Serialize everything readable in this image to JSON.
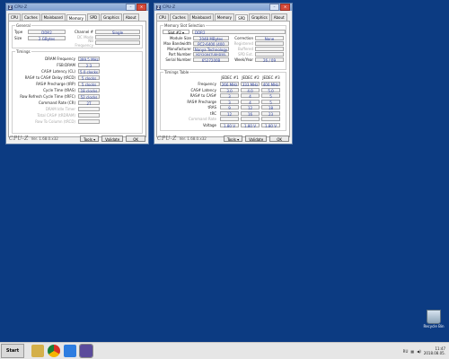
{
  "win1": {
    "title": "CPU-Z",
    "tabs": [
      "CPU",
      "Caches",
      "Mainboard",
      "Memory",
      "SPD",
      "Graphics",
      "About"
    ],
    "active_tab": "Memory",
    "general": {
      "title": "General",
      "type_label": "Type",
      "type_value": "DDR2",
      "size_label": "Size",
      "size_value": "2 GBytes",
      "channel_label": "Channel #",
      "channel_value": "Single",
      "dcmode_label": "DC Mode",
      "nbfreq_label": "NB Frequency"
    },
    "timings": {
      "title": "Timings",
      "rows": [
        {
          "label": "DRAM Frequency",
          "value": "399.5 MHz",
          "dim": false
        },
        {
          "label": "FSB:DRAM",
          "value": "2:3",
          "dim": false
        },
        {
          "label": "CAS# Latency (CL)",
          "value": "5.0 clocks",
          "dim": false
        },
        {
          "label": "RAS# to CAS# Delay (tRCD)",
          "value": "5 clocks",
          "dim": false
        },
        {
          "label": "RAS# Precharge (tRP)",
          "value": "5 clocks",
          "dim": false
        },
        {
          "label": "Cycle Time (tRAS)",
          "value": "18 clocks",
          "dim": false
        },
        {
          "label": "Row Refresh Cycle Time (tRFC)",
          "value": "52 clocks",
          "dim": false
        },
        {
          "label": "Command Rate (CR)",
          "value": "2T",
          "dim": false
        },
        {
          "label": "DRAM Idle Timer",
          "value": "",
          "dim": true
        },
        {
          "label": "Total CAS# (tRDRAM)",
          "value": "",
          "dim": true
        },
        {
          "label": "Row To Column (tRCD)",
          "value": "",
          "dim": true
        }
      ]
    },
    "bottom": {
      "logo": "CPU-Z",
      "version": "Ver. 1.68.0.x32",
      "tools": "Tools",
      "validate": "Validate",
      "ok": "OK"
    }
  },
  "win2": {
    "title": "CPU-Z",
    "tabs": [
      "CPU",
      "Caches",
      "Mainboard",
      "Memory",
      "SPD",
      "Graphics",
      "About"
    ],
    "active_tab": "SPD",
    "slot": {
      "title": "Memory Slot Selection",
      "selected": "Slot #2",
      "type_value": "DDR2",
      "module_size_label": "Module Size",
      "module_size_value": "2048 MBytes",
      "max_bw_label": "Max Bandwidth",
      "max_bw_value": "PC2-6400 (400 MHz)",
      "manufacturer_label": "Manufacturer",
      "manufacturer_value": "Nanya Technology",
      "part_label": "Part Number",
      "part_value": "M2Y2G64TU8HD5B-AC",
      "serial_label": "Serial Number",
      "serial_value": "6527200B",
      "correction_label": "Correction",
      "correction_value": "None",
      "registered_label": "Registered",
      "buffered_label": "Buffered",
      "spdext_label": "SPD Ext.",
      "weekyear_label": "Week/Year",
      "weekyear_value": "26 / 09"
    },
    "timings_table": {
      "title": "Timings Table",
      "columns": [
        "JEDEC #1",
        "JEDEC #2",
        "JEDEC #3"
      ],
      "rows": [
        {
          "label": "Frequency",
          "values": [
            "266 MHz",
            "333 MHz",
            "400 MHz"
          ],
          "dim": false
        },
        {
          "label": "CAS# Latency",
          "values": [
            "3.0",
            "4.0",
            "5.0"
          ],
          "dim": false
        },
        {
          "label": "RAS# to CAS#",
          "values": [
            "3",
            "4",
            "5"
          ],
          "dim": false
        },
        {
          "label": "RAS# Precharge",
          "values": [
            "3",
            "4",
            "5"
          ],
          "dim": false
        },
        {
          "label": "tRAS",
          "values": [
            "9",
            "12",
            "18"
          ],
          "dim": false
        },
        {
          "label": "tRC",
          "values": [
            "12",
            "16",
            "23"
          ],
          "dim": false
        },
        {
          "label": "Command Rate",
          "values": [
            "",
            "",
            ""
          ],
          "dim": true
        },
        {
          "label": "Voltage",
          "values": [
            "1.80 V",
            "1.80 V",
            "1.80 V"
          ],
          "dim": false
        }
      ]
    },
    "bottom": {
      "logo": "CPU-Z",
      "version": "Ver. 1.68.0.x32",
      "tools": "Tools",
      "validate": "Validate",
      "ok": "OK"
    }
  },
  "desktop": {
    "recycle_label": "Recycle Bin"
  },
  "taskbar": {
    "start_label": "Start",
    "lang": "RU",
    "time": "11:47",
    "date": "2018.08.05."
  }
}
